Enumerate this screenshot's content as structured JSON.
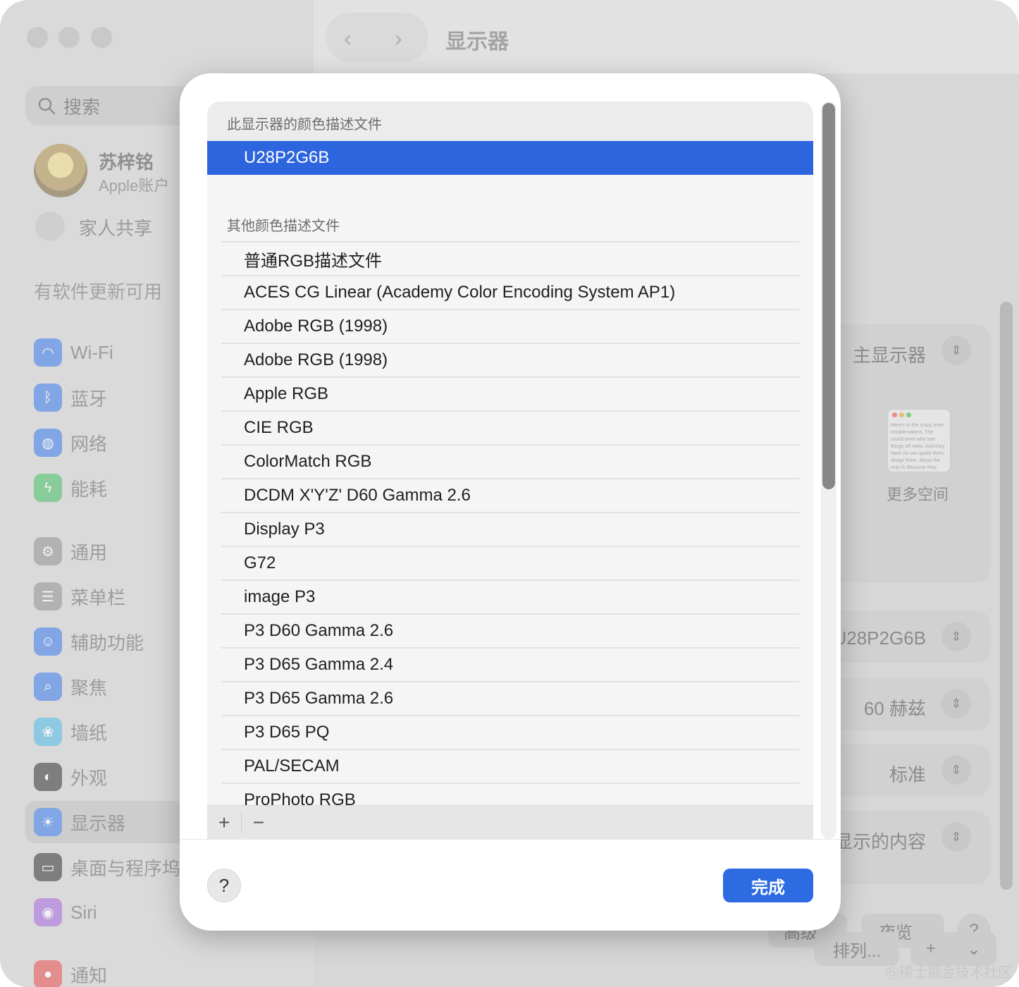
{
  "window": {
    "title": "显示器"
  },
  "sidebar": {
    "search_placeholder": "搜索",
    "user": {
      "name": "苏梓铭",
      "subtitle": "Apple账户"
    },
    "family": "家人共享",
    "update_notice": "有软件更新可用",
    "items": [
      {
        "label": "Wi-Fi",
        "icon": "wifi-icon",
        "color": "#3b82f6"
      },
      {
        "label": "蓝牙",
        "icon": "bluetooth-icon",
        "color": "#3b82f6"
      },
      {
        "label": "网络",
        "icon": "globe-icon",
        "color": "#3b82f6"
      },
      {
        "label": "能耗",
        "icon": "bolt-icon",
        "color": "#34c759"
      },
      {
        "label": "通用",
        "icon": "gear-icon",
        "color": "#8e8e93"
      },
      {
        "label": "菜单栏",
        "icon": "menubar-icon",
        "color": "#8e8e93"
      },
      {
        "label": "辅助功能",
        "icon": "accessibility-icon",
        "color": "#3b82f6"
      },
      {
        "label": "聚焦",
        "icon": "spotlight-icon",
        "color": "#3b82f6"
      },
      {
        "label": "墙纸",
        "icon": "wallpaper-icon",
        "color": "#38bdf8"
      },
      {
        "label": "外观",
        "icon": "appearance-icon",
        "color": "#1c1c1e"
      },
      {
        "label": "显示器",
        "icon": "display-icon",
        "color": "#3b82f6"
      },
      {
        "label": "桌面与程序坞",
        "icon": "dock-icon",
        "color": "#1c1c1e"
      },
      {
        "label": "Siri",
        "icon": "siri-icon",
        "color": "#a855f7"
      },
      {
        "label": "通知",
        "icon": "notification-icon",
        "color": "#ef4444"
      }
    ]
  },
  "main": {
    "display_select": "主显示器",
    "thumbnail_caption": "更多空间",
    "thumbnail_text": "Here's to the crazy ones troublemakers. The round ones who see things dif rules. And they have no can quote them, disagr them. About the only th Because they change th",
    "color_profile_value": "U28P2G6B",
    "refresh_rate": "60 赫兹",
    "rotation": "标准",
    "hdr_label": "显示的内容",
    "arrange_button": "排列...",
    "advanced_button": "高级...",
    "night_shift_button": "夜览...",
    "help": "?",
    "add": "+",
    "chevron": "⌄"
  },
  "sheet": {
    "current_section": "此显示器的颜色描述文件",
    "selected_profile": "U28P2G6B",
    "other_section": "其他颜色描述文件",
    "profiles": [
      "普通RGB描述文件",
      "ACES CG Linear (Academy Color Encoding System AP1)",
      "Adobe RGB (1998)",
      "Adobe RGB (1998)",
      "Apple RGB",
      "CIE RGB",
      "ColorMatch RGB",
      "DCDM X'Y'Z' D60 Gamma 2.6",
      "Display P3",
      "G72",
      "image P3",
      "P3 D60 Gamma 2.6",
      "P3 D65 Gamma 2.4",
      "P3 D65 Gamma 2.6",
      "P3 D65 PQ",
      "PAL/SECAM",
      "ProPhoto RGB"
    ],
    "add_label": "+",
    "remove_label": "−",
    "help_label": "?",
    "done_label": "完成",
    "accent_color": "#2d65de"
  },
  "watermark": "@稀土掘金技术社区"
}
